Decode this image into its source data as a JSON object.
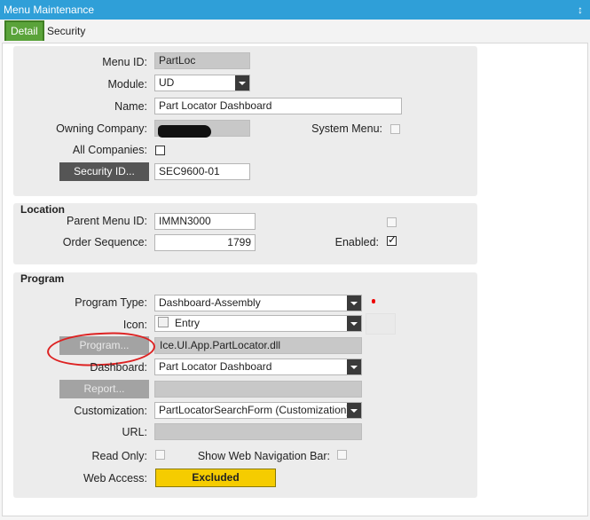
{
  "window": {
    "title": "Menu Maintenance",
    "pin_glyph": "↕"
  },
  "tabs": [
    {
      "label": "Detail"
    },
    {
      "label": "Security"
    }
  ],
  "detail": {
    "menu_id": {
      "label": "Menu ID:",
      "value": "PartLoc"
    },
    "module": {
      "label": "Module:",
      "value": "UD"
    },
    "name": {
      "label": "Name:",
      "value": "Part Locator Dashboard"
    },
    "owning_company": {
      "label": "Owning Company:"
    },
    "system_menu": {
      "label": "System Menu:",
      "checked": false
    },
    "all_companies": {
      "label": "All Companies:",
      "checked": false
    },
    "security_id": {
      "button": "Security ID...",
      "value": "SEC9600-01"
    }
  },
  "location": {
    "title": "Location",
    "parent_menu_id": {
      "label": "Parent Menu ID:",
      "value": "IMMN3000"
    },
    "order_sequence": {
      "label": "Order Sequence:",
      "value": "1799"
    },
    "enabled": {
      "label": "Enabled:",
      "checked": true
    }
  },
  "program": {
    "title": "Program",
    "program_type": {
      "label": "Program Type:",
      "value": "Dashboard-Assembly"
    },
    "icon": {
      "label": "Icon:",
      "value": "Entry"
    },
    "program": {
      "button": "Program...",
      "value": "Ice.UI.App.PartLocator.dll"
    },
    "dashboard": {
      "label": "Dashboard:",
      "value": "Part Locator Dashboard"
    },
    "report": {
      "button": "Report...",
      "value": ""
    },
    "customization": {
      "label": "Customization:",
      "value": "PartLocatorSearchForm (Customization)"
    },
    "url": {
      "label": "URL:",
      "value": ""
    },
    "read_only": {
      "label": "Read Only:",
      "checked": false
    },
    "show_web_nav": {
      "label": "Show Web Navigation Bar:",
      "checked": false
    },
    "web_access": {
      "label": "Web Access:",
      "value": "Excluded"
    }
  },
  "colors": {
    "title_bar": "#2f9fd8",
    "active_tab": "#5aa33a",
    "web_access": "#f5cc00",
    "annotation": "#dd2222"
  }
}
